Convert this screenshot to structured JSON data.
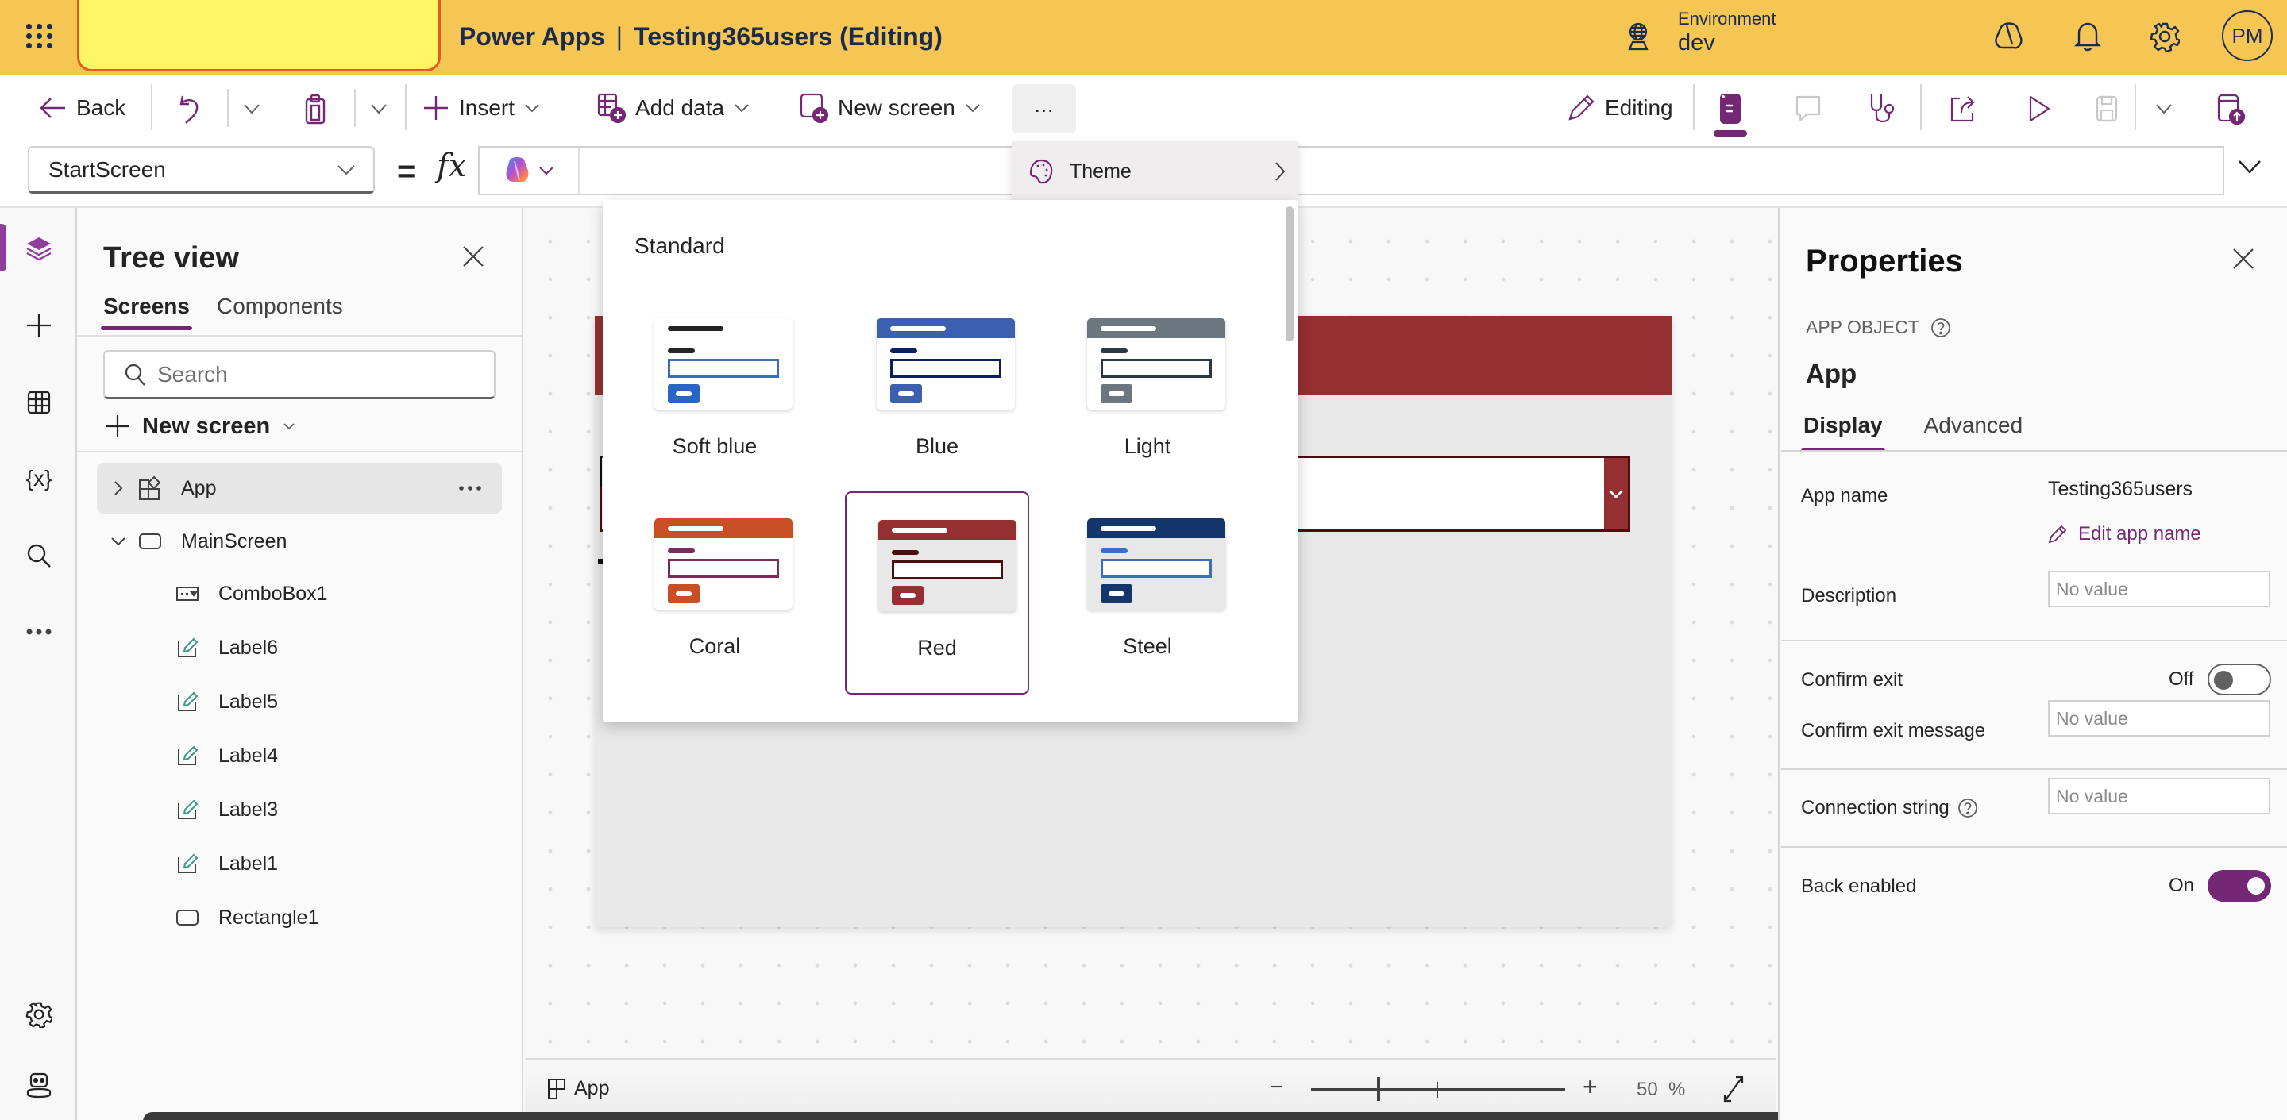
{
  "header": {
    "app_name": "Power Apps",
    "separator": "|",
    "document_title": "Testing365users (Editing)",
    "environment_label": "Environment",
    "environment_value": "dev",
    "avatar_initials": "PM",
    "brand_color": "#f5c653"
  },
  "command_bar": {
    "back_label": "Back",
    "insert_label": "Insert",
    "add_data_label": "Add data",
    "new_screen_label": "New screen",
    "more_label": "...",
    "editing_label": "Editing"
  },
  "formula_bar": {
    "property_selected": "StartScreen",
    "equals": "=",
    "fx": "fx",
    "formula_value": ""
  },
  "overflow_menu": {
    "items": [
      {
        "label": "Theme",
        "icon": "palette-icon"
      }
    ]
  },
  "theme_flyout": {
    "section_heading": "Standard",
    "selected": "Red",
    "themes": [
      {
        "name": "Soft blue",
        "header_color": "#ffffff",
        "title_color": "#242424",
        "label_color": "#242424",
        "input_border": "#3a6fb3",
        "button_color": "#2a64c5",
        "body_color": "#ffffff"
      },
      {
        "name": "Blue",
        "header_color": "#3c5fb0",
        "title_color": "#ffffff",
        "label_color": "#0c1f63",
        "input_border": "#0c1f63",
        "button_color": "#3c5fb0",
        "body_color": "#ffffff"
      },
      {
        "name": "Light",
        "header_color": "#6b7681",
        "title_color": "#ffffff",
        "label_color": "#2b3846",
        "input_border": "#2b3846",
        "button_color": "#6b7681",
        "body_color": "#ffffff"
      },
      {
        "name": "Coral",
        "header_color": "#c84f24",
        "title_color": "#ffffff",
        "label_color": "#7b2a5c",
        "input_border": "#7b2a5c",
        "button_color": "#c84f24",
        "body_color": "#ffffff"
      },
      {
        "name": "Red",
        "header_color": "#953032",
        "title_color": "#ffffff",
        "label_color": "#4f0c0f",
        "input_border": "#4f0c0f",
        "button_color": "#953032",
        "body_color": "#e8e8e8"
      },
      {
        "name": "Steel",
        "header_color": "#14366b",
        "title_color": "#ffffff",
        "label_color": "#3a6fc4",
        "input_border": "#3a6fc4",
        "button_color": "#14366b",
        "body_color": "#e8e8e8"
      }
    ]
  },
  "tree_view": {
    "title": "Tree view",
    "tabs": [
      {
        "label": "Screens",
        "active": true
      },
      {
        "label": "Components",
        "active": false
      }
    ],
    "search_placeholder": "Search",
    "new_screen_label": "New screen",
    "items": [
      {
        "label": "App",
        "type": "app",
        "level": 0,
        "expander": "collapsed",
        "selected": true
      },
      {
        "label": "MainScreen",
        "type": "screen",
        "level": 0,
        "expander": "expanded",
        "selected": false
      },
      {
        "label": "ComboBox1",
        "type": "combobox",
        "level": 1
      },
      {
        "label": "Label6",
        "type": "label",
        "level": 1
      },
      {
        "label": "Label5",
        "type": "label",
        "level": 1
      },
      {
        "label": "Label4",
        "type": "label",
        "level": 1
      },
      {
        "label": "Label3",
        "type": "label",
        "level": 1
      },
      {
        "label": "Label1",
        "type": "label",
        "level": 1
      },
      {
        "label": "Rectangle1",
        "type": "rectangle",
        "level": 1
      }
    ]
  },
  "rail": {
    "items": [
      "tree-view",
      "insert",
      "data",
      "variables",
      "search",
      "more",
      "settings",
      "virtual-agent"
    ],
    "active": "tree-view"
  },
  "canvas": {
    "screen_header_color": "#953032",
    "screen_bg_color": "#e8e8e8"
  },
  "status_bar": {
    "selected_object": "App",
    "zoom_minus": "−",
    "zoom_plus": "+",
    "zoom_percent": "50",
    "zoom_unit": "%"
  },
  "properties": {
    "title": "Properties",
    "object_type": "APP OBJECT",
    "object_name": "App",
    "tabs": [
      {
        "label": "Display",
        "active": true
      },
      {
        "label": "Advanced",
        "active": false
      }
    ],
    "app_name_label": "App name",
    "app_name_value": "Testing365users",
    "edit_app_name_label": "Edit app name",
    "description_label": "Description",
    "description_placeholder": "No value",
    "confirm_exit_label": "Confirm exit",
    "confirm_exit_state": "Off",
    "confirm_exit_message_label": "Confirm exit message",
    "confirm_exit_message_placeholder": "No value",
    "connection_string_label": "Connection string",
    "connection_string_placeholder": "No value",
    "back_enabled_label": "Back enabled",
    "back_enabled_state": "On",
    "accent_color": "#742774"
  }
}
